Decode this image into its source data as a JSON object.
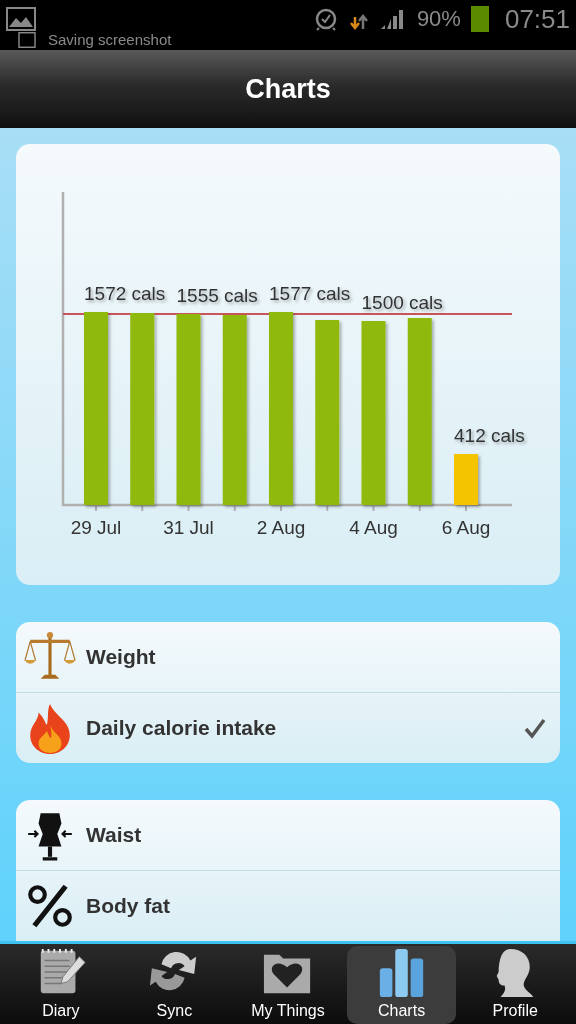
{
  "status_bar": {
    "notification": "Saving screenshot",
    "battery": "90%",
    "time": "07:51"
  },
  "header": {
    "title": "Charts"
  },
  "chart": {
    "bars": [
      {
        "color": "#8fba0a",
        "value_label": "1572 cals",
        "axis_label": "29 Jul"
      },
      {
        "color": "#8fba0a"
      },
      {
        "color": "#8fba0a",
        "value_label": "1555 cals",
        "axis_label": "31 Jul"
      },
      {
        "color": "#8fba0a"
      },
      {
        "color": "#8fba0a",
        "value_label": "1577 cals",
        "axis_label": "2 Aug"
      },
      {
        "color": "#8fba0a"
      },
      {
        "color": "#8fba0a",
        "value_label": "1500 cals",
        "axis_label": "4 Aug"
      },
      {
        "color": "#8fba0a"
      },
      {
        "color": "#f5c400",
        "value_label": "412 cals",
        "axis_label": "6 Aug"
      }
    ]
  },
  "lists": [
    {
      "items": [
        {
          "kind": "scales",
          "label": "Weight",
          "selected": false
        },
        {
          "kind": "flame",
          "label": "Daily calorie intake",
          "selected": true
        }
      ]
    },
    {
      "items": [
        {
          "kind": "dress-form",
          "label": "Waist",
          "selected": false
        },
        {
          "kind": "percent",
          "label": "Body fat",
          "selected": false
        }
      ]
    }
  ],
  "tabs": [
    {
      "kind": "notepad",
      "label": "Diary",
      "selected": false
    },
    {
      "kind": "sync",
      "label": "Sync",
      "selected": false
    },
    {
      "kind": "folder-heart",
      "label": "My Things",
      "selected": false
    },
    {
      "kind": "bars",
      "label": "Charts",
      "selected": true
    },
    {
      "kind": "head",
      "label": "Profile",
      "selected": false
    }
  ]
}
